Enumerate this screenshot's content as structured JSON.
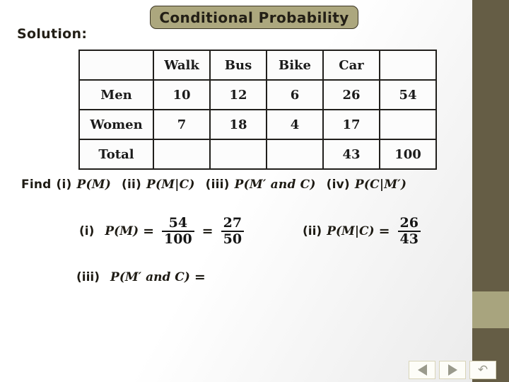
{
  "slide": {
    "title": "Conditional Probability",
    "solution_label": "Solution:"
  },
  "table": {
    "headers": [
      "",
      "Walk",
      "Bus",
      "Bike",
      "Car",
      ""
    ],
    "rows": [
      {
        "label": "Men",
        "cells": [
          "10",
          "12",
          "6",
          "26",
          "54"
        ],
        "highlight_index": 3
      },
      {
        "label": "Women",
        "cells": [
          "7",
          "18",
          "4",
          "17",
          ""
        ],
        "highlight_index": -1
      },
      {
        "label": "Total",
        "cells": [
          "",
          "",
          "",
          "43",
          "100"
        ],
        "highlight_index": 3
      }
    ],
    "highlight_color": "#1a1ab0"
  },
  "question": {
    "lead": "Find",
    "items": [
      {
        "marker": "(i)",
        "expr": "P(M)"
      },
      {
        "marker": "(ii)",
        "expr": "P(M|C)"
      },
      {
        "marker": "(iii)",
        "expr": "P(M′ and C)"
      },
      {
        "marker": "(iv)",
        "expr": "P(C|M′)"
      }
    ]
  },
  "answers": [
    {
      "marker": "(i)",
      "expr": "P(M)",
      "equals": "=",
      "fraction1": {
        "num": "54",
        "den": "100"
      },
      "equals2": "=",
      "fraction2": {
        "num": "27",
        "den": "50"
      }
    },
    {
      "marker": "(ii)",
      "expr": "P(M|C)",
      "equals": "=",
      "fraction1": {
        "num": "26",
        "den": "43"
      }
    },
    {
      "marker": "(iii)",
      "expr": "P(M′ and C)",
      "equals": "="
    }
  ],
  "nav": {
    "previous": "previous-slide",
    "next": "next-slide",
    "return": "return-slide"
  },
  "theme": {
    "banner_fill": "#ACA77E",
    "banner_border": "#3b3524",
    "rail_dark": "#655D45",
    "rail_light": "#A8A47E",
    "text": "#1e1b14"
  }
}
